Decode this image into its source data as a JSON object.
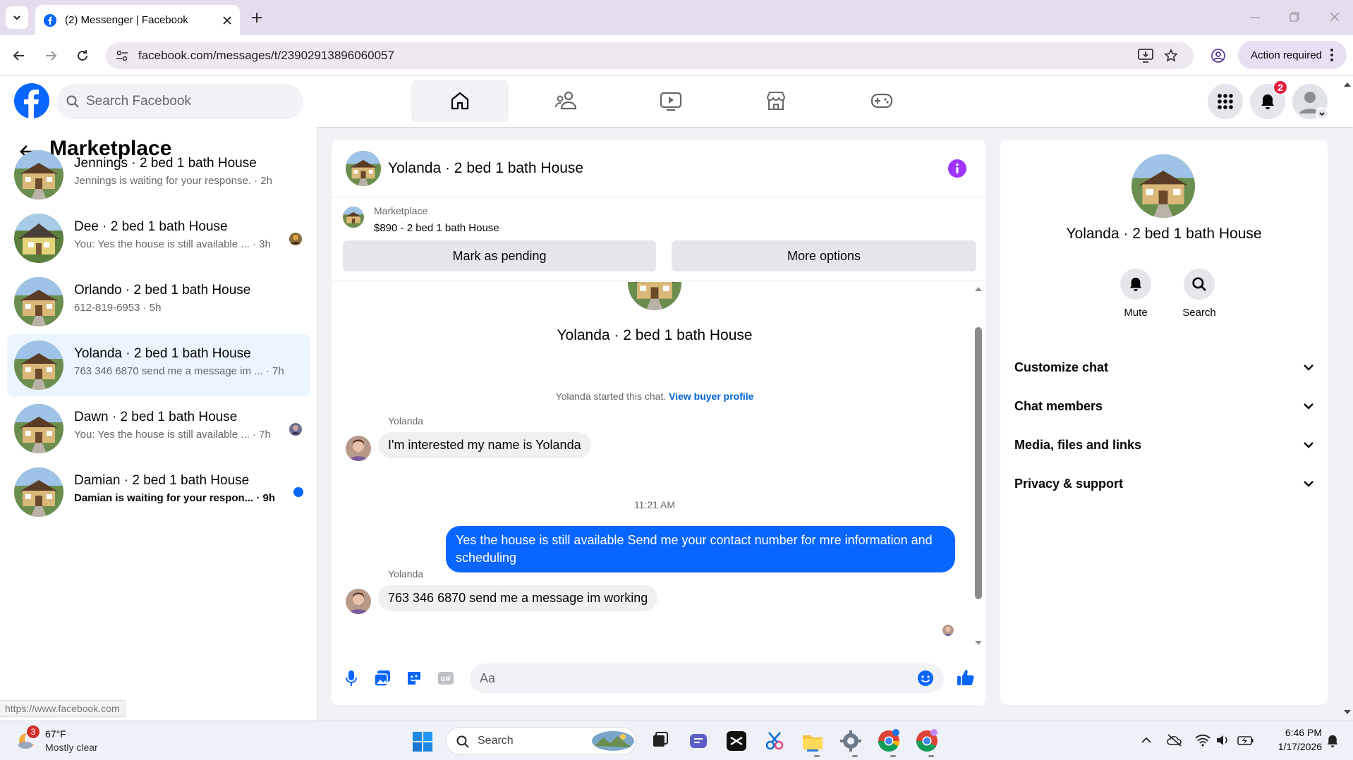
{
  "browser": {
    "tab_title": "(2) Messenger | Facebook",
    "url": "facebook.com/messages/t/23902913896060057",
    "action_required": "Action required",
    "status_url": "https://www.facebook.com"
  },
  "header": {
    "search_placeholder": "Search Facebook",
    "notification_count": "2"
  },
  "sidebar": {
    "title": "Marketplace",
    "conversations": [
      {
        "name": "Jennings · 2 bed 1 bath House",
        "preview": "Jennings is waiting for your response. · 2h"
      },
      {
        "name": "Dee · 2 bed 1 bath House",
        "preview": "You: Yes the house is still available ... · 3h"
      },
      {
        "name": "Orlando · 2 bed 1 bath House",
        "preview": "612-819-6953 · 5h"
      },
      {
        "name": "Yolanda · 2 bed 1 bath House",
        "preview": "763 346 6870 send me a message im ... · 7h"
      },
      {
        "name": "Dawn · 2 bed 1 bath House",
        "preview": "You: Yes the house is still available ... · 7h"
      },
      {
        "name": "Damian · 2 bed 1 bath House",
        "preview": "Damian is waiting for your respon... · 9h"
      }
    ]
  },
  "chat": {
    "title": "Yolanda · 2 bed 1 bath House",
    "listing_source": "Marketplace",
    "listing_price": "$890 - 2 bed 1 bath House",
    "mark_pending": "Mark as pending",
    "more_options": "More options",
    "intro_title": "Yolanda · 2 bed 1 bath House",
    "started_text": "Yolanda started this chat.",
    "view_profile": "View buyer profile",
    "sender1": "Yolanda",
    "msg1": "I'm interested my name is Yolanda",
    "timestamp": "11:21 AM",
    "msg2": "Yes the house is still available  Send me your contact number for mre information and  scheduling",
    "sender2": "Yolanda",
    "msg3": "763 346 6870 send me a message im working",
    "composer_placeholder": "Aa"
  },
  "details": {
    "title": "Yolanda · 2 bed 1 bath House",
    "mute": "Mute",
    "search": "Search",
    "items": [
      "Customize chat",
      "Chat members",
      "Media, files and links",
      "Privacy & support"
    ]
  },
  "taskbar": {
    "weather_temp": "67°F",
    "weather_desc": "Mostly clear",
    "weather_badge": "3",
    "search": "Search",
    "time": "6:46 PM",
    "date": "1/17/2026"
  },
  "colors": {
    "fb_blue": "#0866ff",
    "accent_purple": "#a033ff",
    "notif_red": "#e41e3f"
  }
}
